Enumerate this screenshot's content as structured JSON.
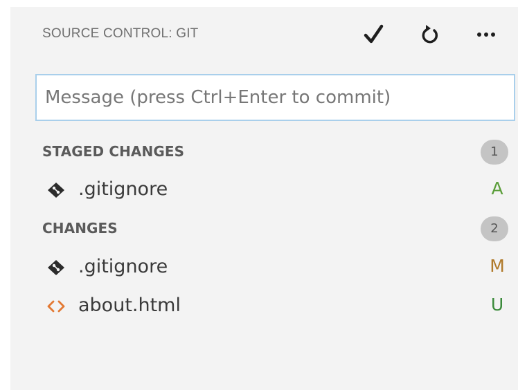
{
  "header": {
    "title": "SOURCE CONTROL: GIT",
    "commit_icon": "check-icon",
    "refresh_icon": "refresh-icon",
    "more_icon": "ellipsis-icon"
  },
  "commit": {
    "placeholder": "Message (press Ctrl+Enter to commit)",
    "value": ""
  },
  "groups": [
    {
      "label": "STAGED CHANGES",
      "count": "1",
      "files": [
        {
          "name": ".gitignore",
          "icon": "git-file-icon",
          "status": "A",
          "status_color": "#5b9e3a"
        }
      ]
    },
    {
      "label": "CHANGES",
      "count": "2",
      "files": [
        {
          "name": ".gitignore",
          "icon": "git-file-icon",
          "status": "M",
          "status_color": "#b07a2a"
        },
        {
          "name": "about.html",
          "icon": "html-code-icon",
          "status": "U",
          "status_color": "#3a8a3a"
        }
      ]
    }
  ],
  "colors": {
    "panel_bg": "#f3f3f3",
    "input_border": "#a9cfeb",
    "badge_bg": "#c4c4c4",
    "html_icon": "#e37933"
  }
}
